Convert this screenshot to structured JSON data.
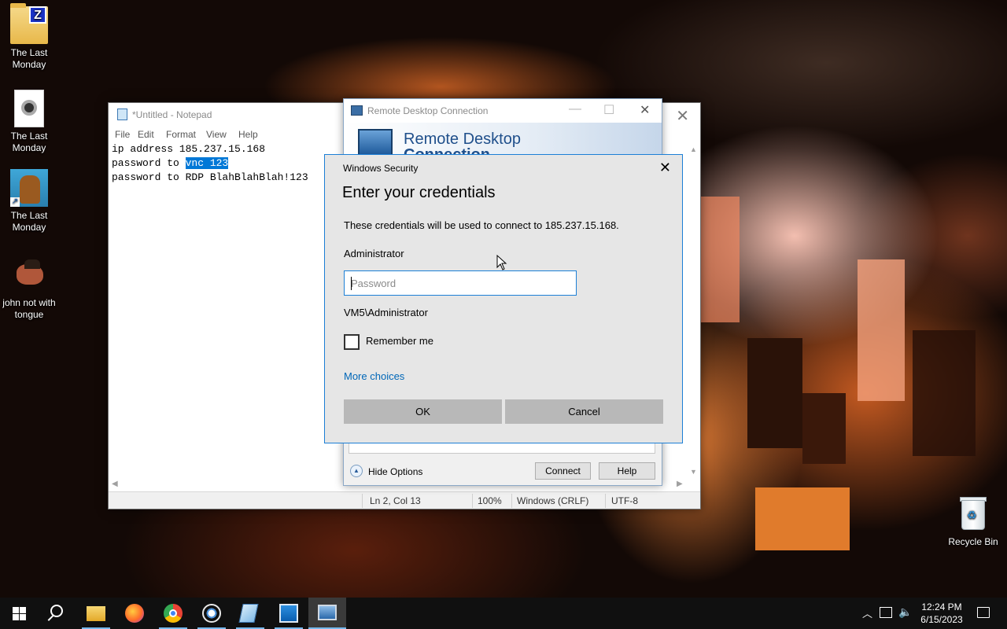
{
  "desktop": {
    "icons": [
      {
        "label": "The Last Monday",
        "icon": "winzip-folder-icon"
      },
      {
        "label": "The Last Monday",
        "icon": "document-icon"
      },
      {
        "label": "The Last Monday",
        "icon": "image-shortcut-icon"
      },
      {
        "label": "john not with tongue",
        "icon": "image-icon"
      },
      {
        "label": "Recycle Bin",
        "icon": "recycle-bin-icon"
      }
    ]
  },
  "notepad": {
    "title": "*Untitled - Notepad",
    "menu": [
      "File",
      "Edit",
      "Format",
      "View",
      "Help"
    ],
    "lines": [
      "ip address 185.237.15.168",
      "password to ",
      "vnc 123",
      "password to RDP BlahBlahBlah!123"
    ],
    "status": {
      "position": "Ln 2, Col 13",
      "zoom": "100%",
      "line_ending": "Windows (CRLF)",
      "encoding": "UTF-8"
    }
  },
  "rdc": {
    "title": "Remote Desktop Connection",
    "banner_line1": "Remote Desktop",
    "banner_line2": "Connection",
    "hide_options": "Hide Options",
    "connect": "Connect",
    "help": "Help"
  },
  "security": {
    "caption": "Windows Security",
    "heading": "Enter your credentials",
    "description": "These credentials will be used to connect to 185.237.15.168.",
    "username": "Administrator",
    "password_placeholder": "Password",
    "domain_user": "VM5\\Administrator",
    "remember_label": "Remember me",
    "remember_checked": false,
    "more_choices": "More choices",
    "ok": "OK",
    "cancel": "Cancel",
    "accent_color": "#1c7fd6"
  },
  "taskbar": {
    "apps": [
      "start-icon",
      "search-icon",
      "file-explorer-icon",
      "firefox-icon",
      "chrome-icon",
      "paint-icon",
      "notepad-icon",
      "photos-icon",
      "remote-desktop-icon"
    ],
    "time": "12:24 PM",
    "date": "6/15/2023"
  }
}
